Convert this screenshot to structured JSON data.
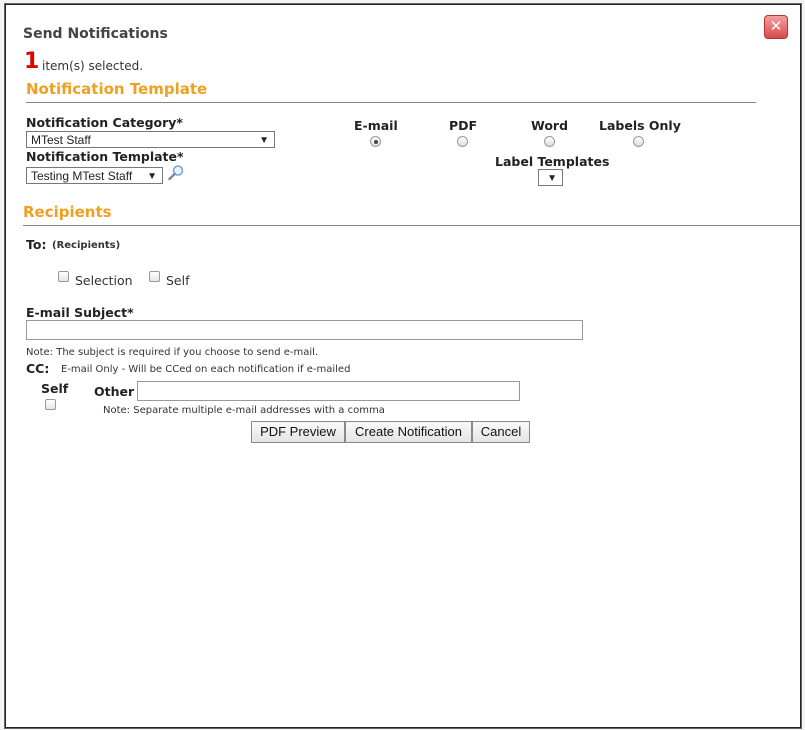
{
  "dialog": {
    "title": "Send Notifications",
    "close_symbol": "✕",
    "selected_count": "1",
    "selected_label": "item(s) selected."
  },
  "template_section": {
    "heading": "Notification Template",
    "category_label": "Notification Category*",
    "category_value": "MTest Staff",
    "template_label": "Notification Template*",
    "template_value": "Testing MTest Staff",
    "formats": [
      {
        "label": "E-mail",
        "selected": true
      },
      {
        "label": "PDF",
        "selected": false
      },
      {
        "label": "Word",
        "selected": false
      },
      {
        "label": "Labels Only",
        "selected": false
      }
    ],
    "label_templates_label": "Label Templates",
    "label_templates_value": ""
  },
  "recipients": {
    "heading": "Recipients",
    "to_label": "To:",
    "to_sub": "(Recipients)",
    "options": [
      {
        "label": "Selection",
        "checked": false
      },
      {
        "label": "Self",
        "checked": false
      }
    ],
    "subject_label": "E-mail Subject*",
    "subject_value": "",
    "subject_note": "Note: The subject is required if you choose to send e-mail.",
    "cc_label": "CC:",
    "cc_note": "E-mail Only - Will be CCed on each notification if e-mailed",
    "cc_self_label": "Self",
    "cc_other_label": "Other",
    "cc_other_value": "",
    "cc_other_note": "Note: Separate multiple e-mail addresses with a comma"
  },
  "actions": {
    "pdf_preview": "PDF Preview",
    "create": "Create Notification",
    "cancel": "Cancel"
  },
  "icons": {
    "search": "magnifier-icon",
    "close": "close-icon"
  },
  "colors": {
    "section_heading": "#f0a020",
    "count": "#e00000",
    "close_button": "#d84a4a"
  }
}
